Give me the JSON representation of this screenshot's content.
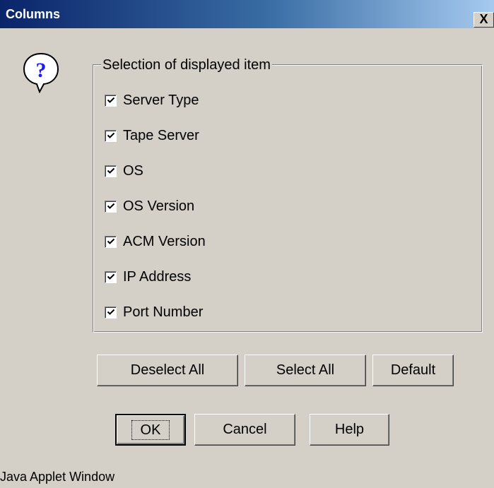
{
  "window": {
    "title": "Columns",
    "close_label": "X"
  },
  "group": {
    "legend": "Selection of displayed item",
    "items": [
      {
        "label": "Server Type",
        "checked": true
      },
      {
        "label": "Tape Server",
        "checked": true
      },
      {
        "label": "OS",
        "checked": true
      },
      {
        "label": "OS Version",
        "checked": true
      },
      {
        "label": "ACM Version",
        "checked": true
      },
      {
        "label": "IP Address",
        "checked": true
      },
      {
        "label": "Port Number",
        "checked": true
      }
    ]
  },
  "selection_buttons": {
    "deselect_all": "Deselect All",
    "select_all": "Select All",
    "default": "Default"
  },
  "dialog_buttons": {
    "ok": "OK",
    "cancel": "Cancel",
    "help": "Help"
  },
  "status": {
    "text": "Java Applet Window"
  },
  "icons": {
    "help": "question-icon",
    "close": "close-icon",
    "check": "check-icon"
  },
  "colors": {
    "titlebar_start": "#0a246a",
    "titlebar_end": "#a6caf0",
    "face": "#d4d0c8",
    "help_icon_fill": "#1a1aff"
  }
}
